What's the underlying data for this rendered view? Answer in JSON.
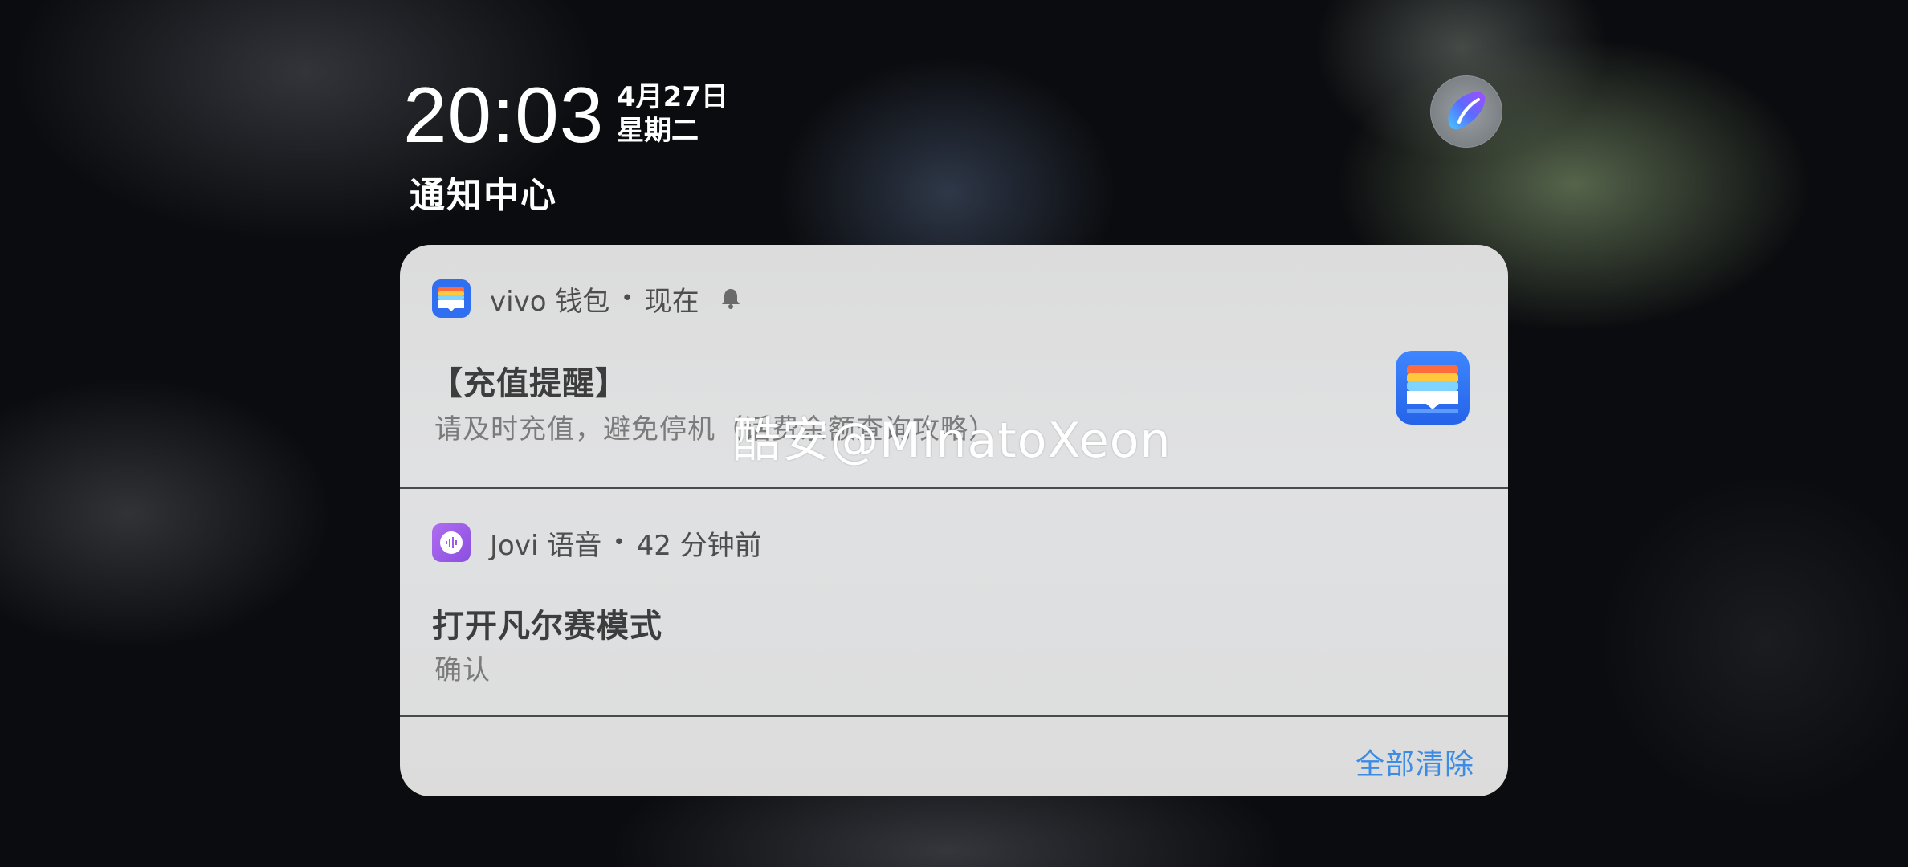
{
  "status": {
    "time": "20:03",
    "date": "4月27日",
    "weekday": "星期二"
  },
  "section_title": "通知中心",
  "assistant_icon": "jovi-assistant-icon",
  "notifications": [
    {
      "app_name": "vivo 钱包",
      "separator": "•",
      "time_label": "现在",
      "has_bell": true,
      "icon": "wallet-icon",
      "title": "【充值提醒】",
      "body": "请及时充值，避免停机（话费余额查询攻略）"
    },
    {
      "app_name": "Jovi 语音",
      "separator": "•",
      "time_label": "42 分钟前",
      "has_bell": false,
      "icon": "voice-icon",
      "title": "打开凡尔赛模式",
      "body": "确认"
    }
  ],
  "clear_all_label": "全部清除",
  "watermark": "酷安@MinatoXeon",
  "colors": {
    "accent": "#3c8ce6",
    "panel_bg": "#dedfe0",
    "wallet_blue": "#2f6ff0",
    "voice_purple": "#9a5ee8"
  }
}
